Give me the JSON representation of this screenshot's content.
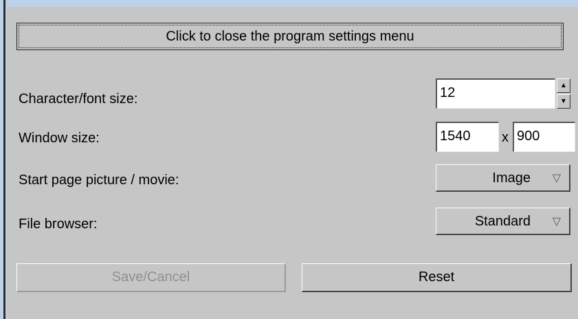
{
  "close_menu_button": "Click to close the program settings menu",
  "settings": {
    "font_size_label": "Character/font size:",
    "font_size_value": "12",
    "window_size_label": "Window size:",
    "window_width": "1540",
    "window_height": "900",
    "window_size_separator": "x",
    "start_page_label": "Start page picture / movie:",
    "start_page_value": "Image",
    "file_browser_label": "File browser:",
    "file_browser_value": "Standard"
  },
  "buttons": {
    "save_cancel": "Save/Cancel",
    "reset": "Reset"
  },
  "icons": {
    "spin_up": "▲",
    "spin_down": "▼",
    "dropdown_arrow": "▽"
  }
}
